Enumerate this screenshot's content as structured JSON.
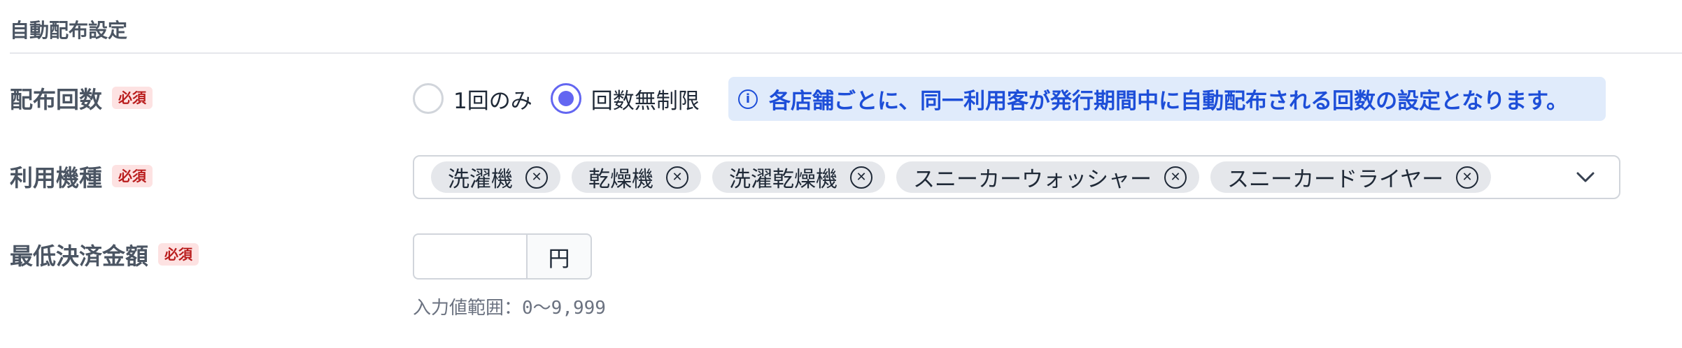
{
  "section": {
    "title": "自動配布設定"
  },
  "required_label": "必須",
  "distribution_count": {
    "label": "配布回数",
    "options": [
      {
        "label": "1回のみ",
        "checked": false
      },
      {
        "label": "回数無制限",
        "checked": true
      }
    ],
    "info_icon": "info-icon",
    "info": "各店舗ごとに、同一利用客が発行期間中に自動配布される回数の設定となります。"
  },
  "machine_types": {
    "label": "利用機種",
    "tags": [
      "洗濯機",
      "乾燥機",
      "洗濯乾燥機",
      "スニーカーウォッシャー",
      "スニーカードライヤー"
    ],
    "remove_icon": "close-circle-icon",
    "dropdown_icon": "chevron-down-icon"
  },
  "min_payment": {
    "label": "最低決済金額",
    "value": "",
    "unit": "円",
    "hint": "入力値範囲：0〜9,999"
  },
  "colors": {
    "accent": "#6366f1",
    "info_bg": "#e0ebfb",
    "info_text": "#1d4ed8",
    "required_bg": "#fde2e2",
    "required_text": "#b91c1c"
  }
}
